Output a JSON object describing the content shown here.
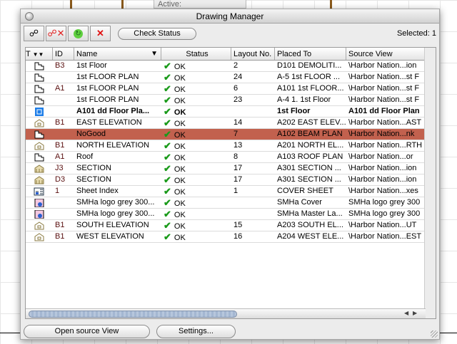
{
  "window": {
    "title": "Drawing Manager",
    "selected": "Selected: 1"
  },
  "background": {
    "text": "Active:"
  },
  "toolbar": {
    "check_status": "Check Status"
  },
  "columns": [
    "T",
    "ID",
    "Name",
    "Status",
    "Layout No.",
    "Placed To",
    "Source View"
  ],
  "rows": [
    {
      "type": "plan",
      "id": "B3",
      "name": "1st Floor",
      "status": "OK",
      "layout": "2",
      "placed": "D101 DEMOLITI...",
      "source": "\\Harbor Nation...ion"
    },
    {
      "type": "plan",
      "id": "",
      "name": "1st FLOOR PLAN",
      "status": "OK",
      "layout": "24",
      "placed": "A-5 1st FLOOR ...",
      "source": "\\Harbor Nation...st F"
    },
    {
      "type": "plan",
      "id": "A1",
      "name": "1st FLOOR PLAN",
      "status": "OK",
      "layout": "6",
      "placed": "A101 1st FLOOR...",
      "source": "\\Harbor Nation...st F"
    },
    {
      "type": "plan",
      "id": "",
      "name": "1st FLOOR PLAN",
      "status": "OK",
      "layout": "23",
      "placed": "A-4 1. 1st Floor",
      "source": "\\Harbor Nation...st F"
    },
    {
      "type": "layout",
      "id": "",
      "name": "A101 dd Floor Pla...",
      "status": "OK",
      "layout": "",
      "placed": "1st Floor",
      "source": "A101 dd Floor Plan",
      "bold": true
    },
    {
      "type": "elevation",
      "id": "B1",
      "name": "EAST ELEVATION",
      "status": "OK",
      "layout": "14",
      "placed": "A202 EAST ELEV...",
      "source": "\\Harbor Nation...AST"
    },
    {
      "type": "plan",
      "id": "",
      "name": "NoGood",
      "status": "OK",
      "layout": "7",
      "placed": "A102 BEAM PLAN",
      "source": "\\Harbor Nation...nk",
      "selected": true
    },
    {
      "type": "elevation",
      "id": "B1",
      "name": "NORTH ELEVATION",
      "status": "OK",
      "layout": "13",
      "placed": "A201 NORTH EL...",
      "source": "\\Harbor Nation...RTH"
    },
    {
      "type": "plan",
      "id": "A1",
      "name": "Roof",
      "status": "OK",
      "layout": "8",
      "placed": "A103 ROOF PLAN",
      "source": "\\Harbor Nation...or"
    },
    {
      "type": "section",
      "id": "J3",
      "name": "SECTION",
      "status": "OK",
      "layout": "17",
      "placed": "A301 SECTION ...",
      "source": "\\Harbor Nation...ion"
    },
    {
      "type": "section",
      "id": "D3",
      "name": "SECTION",
      "status": "OK",
      "layout": "17",
      "placed": "A301 SECTION ...",
      "source": "\\Harbor Nation...ion"
    },
    {
      "type": "index",
      "id": "1",
      "name": "Sheet Index",
      "status": "OK",
      "layout": "1",
      "placed": "COVER SHEET",
      "source": "\\Harbor Nation...xes"
    },
    {
      "type": "image",
      "id": "",
      "name": "SMHa logo grey 300...",
      "status": "OK",
      "layout": "",
      "placed": "SMHa Cover",
      "source": "SMHa logo grey 300"
    },
    {
      "type": "image",
      "id": "",
      "name": "SMHa logo grey 300...",
      "status": "OK",
      "layout": "",
      "placed": "SMHa Master La...",
      "source": "SMHa logo grey 300"
    },
    {
      "type": "elevation",
      "id": "B1",
      "name": "SOUTH ELEVATION",
      "status": "OK",
      "layout": "15",
      "placed": "A203 SOUTH EL...",
      "source": "\\Harbor Nation...UT"
    },
    {
      "type": "elevation",
      "id": "B1",
      "name": "WEST ELEVATION",
      "status": "OK",
      "layout": "16",
      "placed": "A204 WEST ELE...",
      "source": "\\Harbor Nation...EST"
    }
  ],
  "buttons": {
    "open_source": "Open source View",
    "settings": "Settings..."
  },
  "colors": {
    "selection": "#c2614e",
    "check": "#1a9a1a"
  }
}
